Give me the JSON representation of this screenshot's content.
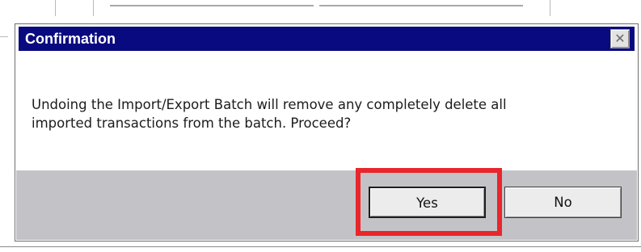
{
  "dialog": {
    "title": "Confirmation",
    "close_glyph": "✕",
    "close_icon": "close-icon",
    "message_line1": "Undoing the Import/Export Batch will remove any completely delete all",
    "message_line2": "imported transactions from the batch.  Proceed?",
    "buttons": {
      "yes_label": "Yes",
      "no_label": "No"
    }
  },
  "colors": {
    "titlebar": "#0a0a80",
    "button_bar": "#c3c3c7",
    "highlight": "#e8262b"
  }
}
